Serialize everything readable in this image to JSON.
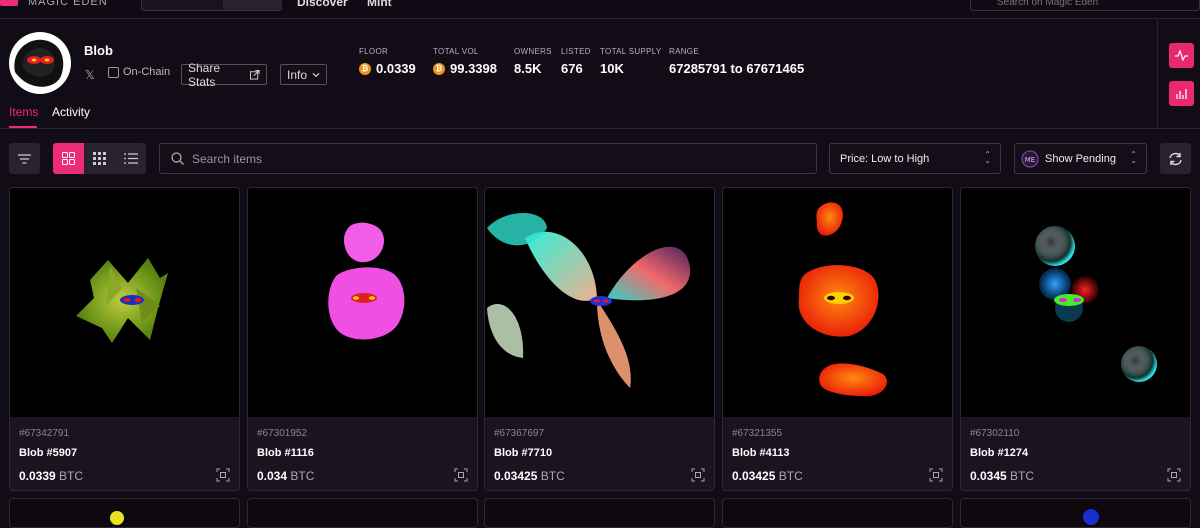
{
  "topbar": {
    "brand": "MAGIC EDEN",
    "nav": [
      "Discover",
      "Mint"
    ],
    "search_placeholder": "Search on Magic Eden"
  },
  "collection": {
    "name": "Blob",
    "x_icon": "x-logo-icon",
    "onchain_label": "On-Chain",
    "share_label": "Share Stats",
    "info_label": "Info"
  },
  "stats": [
    {
      "label": "FLOOR",
      "value": "0.0339",
      "coin": true
    },
    {
      "label": "TOTAL VOL",
      "value": "99.3398",
      "coin": true
    },
    {
      "label": "OWNERS",
      "value": "8.5K",
      "coin": false
    },
    {
      "label": "LISTED",
      "value": "676",
      "coin": false
    },
    {
      "label": "TOTAL SUPPLY",
      "value": "10K",
      "coin": false
    },
    {
      "label": "RANGE",
      "value": "67285791 to 67671465",
      "coin": false
    }
  ],
  "tabs": [
    {
      "label": "Items",
      "active": true
    },
    {
      "label": "Activity",
      "active": false
    }
  ],
  "toolbar": {
    "search_placeholder": "Search items",
    "sort_label": "Price: Low to High",
    "pending_label": "Show Pending"
  },
  "colors": {
    "accent": "#ec2b7a",
    "bg": "#120c17",
    "bitcoin": "#f0931a"
  },
  "items": [
    {
      "inscription": "#67342791",
      "name": "Blob #5907",
      "price": "0.0339",
      "currency": "BTC"
    },
    {
      "inscription": "#67301952",
      "name": "Blob #1116",
      "price": "0.034",
      "currency": "BTC"
    },
    {
      "inscription": "#67367697",
      "name": "Blob #7710",
      "price": "0.03425",
      "currency": "BTC"
    },
    {
      "inscription": "#67321355",
      "name": "Blob #4113",
      "price": "0.03425",
      "currency": "BTC"
    },
    {
      "inscription": "#67302110",
      "name": "Blob #1274",
      "price": "0.0345",
      "currency": "BTC"
    }
  ]
}
